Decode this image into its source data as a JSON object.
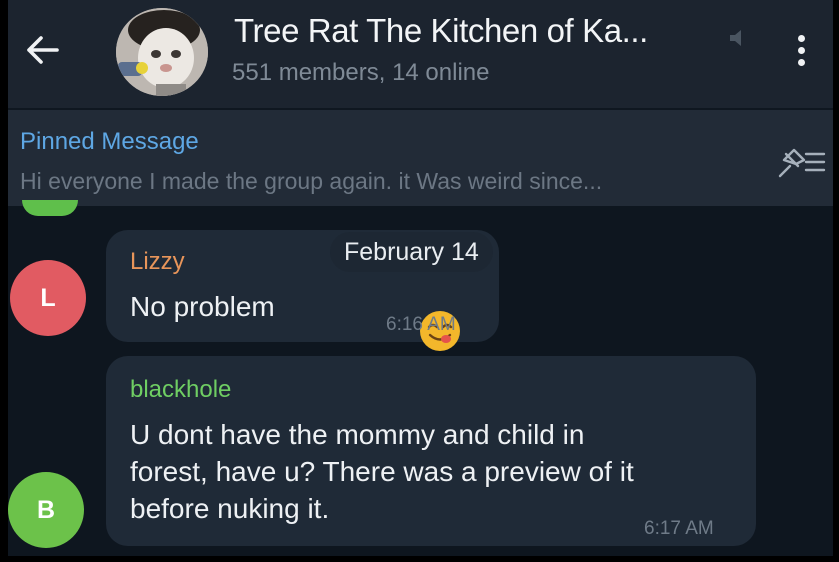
{
  "header": {
    "group_title": "Tree Rat The Kitchen of Ka...",
    "group_subtitle": "551 members, 14 online"
  },
  "pinned": {
    "title": "Pinned Message",
    "text": "Hi everyone I made the group again. it Was weird since..."
  },
  "chat": {
    "date_label": "February 14",
    "messages": [
      {
        "sender": "Lizzy",
        "avatar_letter": "L",
        "avatar_color": "#e15b62",
        "name_color": "#e8955a",
        "text": "No problem",
        "emoji": "😋",
        "time": "6:16 AM"
      },
      {
        "sender": "blackhole",
        "avatar_letter": "B",
        "avatar_color": "#6cc24a",
        "name_color": "#6fce63",
        "lines": [
          "U dont have the mommy and child in",
          "forest, have u? There was a preview of it",
          "before nuking it."
        ],
        "time": "6:17 AM"
      }
    ]
  },
  "colors": {
    "header_bg": "#1c242f",
    "pinned_accent": "#5ea7e4",
    "chat_bg": "#0e161f",
    "bubble_bg": "#1f2a37"
  }
}
